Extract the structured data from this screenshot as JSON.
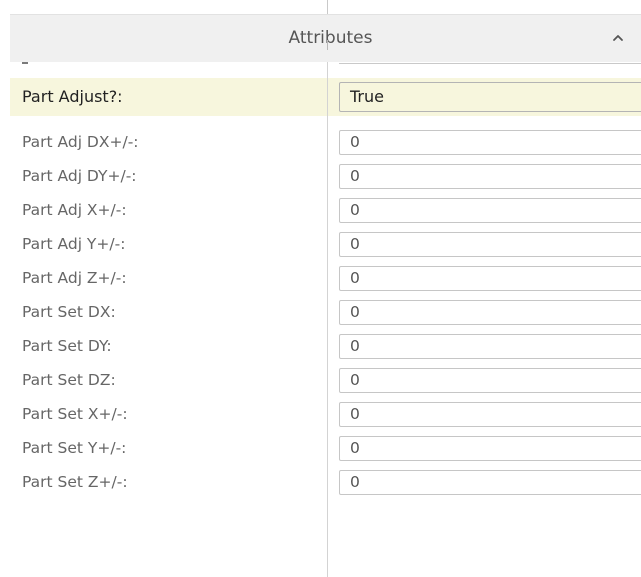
{
  "header": {
    "title": "Attributes",
    "collapse_icon": "chevron-up-icon"
  },
  "colors": {
    "header_bg": "#f0f0f0",
    "highlight_bg": "#f7f6dd",
    "label_text": "#666666",
    "field_border": "#c6c6c6"
  },
  "rows": [
    {
      "label": "Part Adjust?:",
      "value": "True"
    },
    {
      "label": "Part Adj DX+/-:",
      "value": "0"
    },
    {
      "label": "Part Adj DY+/-:",
      "value": "0"
    },
    {
      "label": "Part Adj X+/-:",
      "value": "0"
    },
    {
      "label": "Part Adj Y+/-:",
      "value": "0"
    },
    {
      "label": "Part Adj Z+/-:",
      "value": "0"
    },
    {
      "label": "Part Set DX:",
      "value": "0"
    },
    {
      "label": "Part Set DY:",
      "value": "0"
    },
    {
      "label": "Part Set DZ:",
      "value": "0"
    },
    {
      "label": "Part Set X+/-:",
      "value": "0"
    },
    {
      "label": "Part Set Y+/-:",
      "value": "0"
    },
    {
      "label": "Part Set Z+/-:",
      "value": "0"
    }
  ]
}
